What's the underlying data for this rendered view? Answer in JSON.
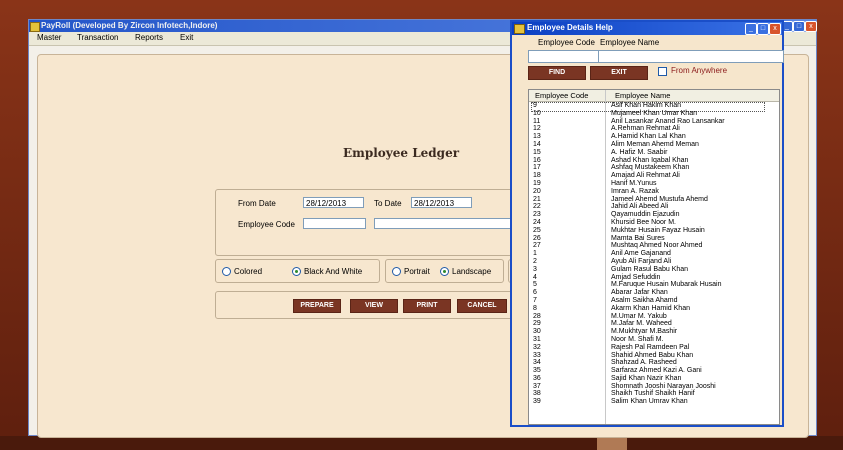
{
  "main_window": {
    "title": "PayRoll (Developed By Zircon Infotech,Indore)",
    "menu": [
      "Master",
      "Transaction",
      "Reports",
      "Exit"
    ]
  },
  "form": {
    "title": "Employee Ledger",
    "from_date_label": "From Date",
    "from_date_value": "28/12/2013",
    "to_date_label": "To Date",
    "to_date_value": "28/12/2013",
    "employee_code_label": "Employee Code",
    "options": {
      "colored": "Colored",
      "black_and_white": "Black And White",
      "portrait": "Portrait",
      "landscape": "Landscape"
    },
    "buttons": {
      "prepare": "PREPARE",
      "view": "VIEW",
      "print": "PRINT",
      "cancel": "CANCEL"
    }
  },
  "dialog": {
    "title": "Employee Details Help",
    "code_label": "Employee Code",
    "name_label": "Employee Name",
    "find_button": "FIND",
    "exit_button": "EXIT",
    "anywhere_label": "From Anywhere",
    "grid_headers": [
      "Employee Code",
      "Employee Name"
    ],
    "rows": [
      [
        "9",
        "Asif Khan Hakim Khan"
      ],
      [
        "10",
        "Mujameel Khan Umar Khan"
      ],
      [
        "11",
        "Anil Lasankar Anand Rao Lansankar"
      ],
      [
        "12",
        "A.Rehman Rehmat Ali"
      ],
      [
        "13",
        "A.Hamid Khan Lal Khan"
      ],
      [
        "14",
        "Alim Meman Ahemd Meman"
      ],
      [
        "15",
        "A. Hafiz M. Saabir"
      ],
      [
        "16",
        "Ashad Khan Iqabal Khan"
      ],
      [
        "17",
        "Ashfaq Mustakeem Khan"
      ],
      [
        "18",
        "Amajad Ali Rehmat Ali"
      ],
      [
        "19",
        "Hanif M.Yunus"
      ],
      [
        "20",
        "Imran A. Razak"
      ],
      [
        "21",
        "Jameel Ahemd Mustufa Ahemd"
      ],
      [
        "22",
        "Jahid Ali Abeed Ali"
      ],
      [
        "23",
        "Qayamuddin Ejazudin"
      ],
      [
        "24",
        "Khursid Bee Noor M."
      ],
      [
        "25",
        "Mukhtar Husain Fayaz Husain"
      ],
      [
        "26",
        "Mamta Bai Sures"
      ],
      [
        "27",
        "Mushtaq Ahmed Noor Ahmed"
      ],
      [
        "1",
        "Anil Ame Gajanand"
      ],
      [
        "2",
        "Ayub Ali Farjand Ali"
      ],
      [
        "3",
        "Gulam Rasul Babu Khan"
      ],
      [
        "4",
        "Amjad Sefuddin"
      ],
      [
        "5",
        "M.Faruque Husain Mubarak Husain"
      ],
      [
        "6",
        "Abarar Jafar Khan"
      ],
      [
        "7",
        "Asalm Saikha Ahamd"
      ],
      [
        "8",
        "Akarm Khan Hamid Khan"
      ],
      [
        "28",
        "M.Umar M. Yakub"
      ],
      [
        "29",
        "M.Jafar M. Waheed"
      ],
      [
        "30",
        "M.Mukhtyar M.Bashir"
      ],
      [
        "31",
        "Noor M. Shafi M."
      ],
      [
        "32",
        "Rajesh Pal Ramdeen Pal"
      ],
      [
        "33",
        "Shahid Ahmed Babu Khan"
      ],
      [
        "34",
        "Shahzad A. Rasheed"
      ],
      [
        "35",
        "Sarfaraz Ahmed Kazi A. Gani"
      ],
      [
        "36",
        "Sajid Khan Nazir Khan"
      ],
      [
        "37",
        "Shomnath Jooshi Narayan Jooshi"
      ],
      [
        "38",
        "Shaikh Tushif Shaikh Hanif"
      ],
      [
        "39",
        "Salim Khan Umrav Khan"
      ]
    ]
  },
  "colors": {
    "title_bar": "#2355c9",
    "button_brown": "#7a3523",
    "form_background": "#f7e7cf"
  }
}
